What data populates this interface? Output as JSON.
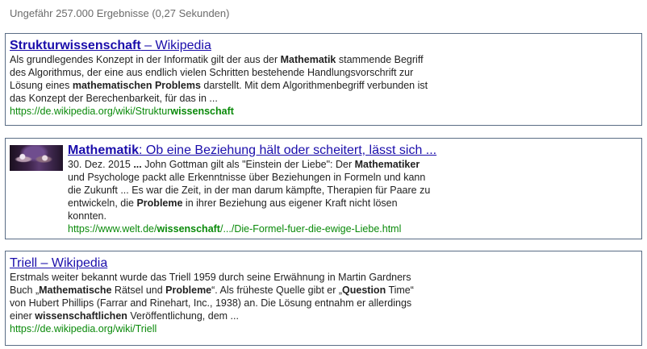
{
  "stats": "Ungefähr 257.000 Ergebnisse (0,27 Sekunden)",
  "results": [
    {
      "title_bold": "Strukturwissenschaft",
      "title_rest": " – Wikipedia",
      "snippet": [
        [
          [
            "Als grundlegendes Konzept in der Informatik gilt der aus der ",
            false
          ],
          [
            "Mathematik",
            true
          ],
          [
            " stammende Begriff",
            false
          ]
        ],
        [
          [
            "des Algorithmus, der eine aus endlich vielen Schritten bestehende Handlungsvorschrift zur",
            false
          ]
        ],
        [
          [
            "Lösung eines ",
            false
          ],
          [
            "mathematischen Problems",
            true
          ],
          [
            " darstellt. Mit dem Algorithmenbegriff verbunden ist",
            false
          ]
        ],
        [
          [
            "das Konzept der Berechenbarkeit, für das in ...",
            false
          ]
        ]
      ],
      "url": [
        [
          "https://de.wikipedia.org/wiki/Struktur",
          false
        ],
        [
          "wissenschaft",
          true
        ]
      ]
    },
    {
      "title_bold": "Mathematik",
      "title_rest": ": Ob eine Beziehung hält oder scheitert, lässt sich ...",
      "thumbnail": "couple-photo-thumbnail",
      "snippet": [
        [
          [
            "30. Dez. 2015 ",
            false
          ],
          [
            "...",
            true
          ],
          [
            " John Gottman gilt als \"Einstein der Liebe\": Der ",
            false
          ],
          [
            "Mathematiker",
            true
          ]
        ],
        [
          [
            "und Psychologe packt alle Erkenntnisse über Beziehungen in Formeln und kann",
            false
          ]
        ],
        [
          [
            "die Zukunft ... Es war die Zeit, in der man darum kämpfte, Therapien für Paare zu",
            false
          ]
        ],
        [
          [
            "entwickeln, die ",
            false
          ],
          [
            "Probleme",
            true
          ],
          [
            " in ihrer Beziehung aus eigener Kraft nicht lösen",
            false
          ]
        ],
        [
          [
            "konnten.",
            false
          ]
        ]
      ],
      "url": [
        [
          "https://www.welt.de/",
          false
        ],
        [
          "wissenschaft",
          true
        ],
        [
          "/.../Die-Formel-fuer-die-ewige-Liebe.html",
          false
        ]
      ]
    },
    {
      "title_bold": "",
      "title_rest": "Triell – Wikipedia",
      "snippet": [
        [
          [
            "Erstmals weiter bekannt wurde das Triell 1959 durch seine Erwähnung in Martin Gardners",
            false
          ]
        ],
        [
          [
            "Buch „",
            false
          ],
          [
            "Mathematische",
            true
          ],
          [
            " Rätsel und ",
            false
          ],
          [
            "Probleme",
            true
          ],
          [
            "“. Als früheste Quelle gibt er „",
            false
          ],
          [
            "Question",
            true
          ],
          [
            " Time“",
            false
          ]
        ],
        [
          [
            "von Hubert Phillips (Farrar and Rinehart, Inc., 1938) an. Die Lösung entnahm er allerdings",
            false
          ]
        ],
        [
          [
            "einer ",
            false
          ],
          [
            "wissenschaftlichen",
            true
          ],
          [
            " Veröffentlichung, dem ...",
            false
          ]
        ]
      ],
      "url": [
        [
          "https://de.wikipedia.org/wiki/Triell",
          false
        ]
      ]
    }
  ]
}
